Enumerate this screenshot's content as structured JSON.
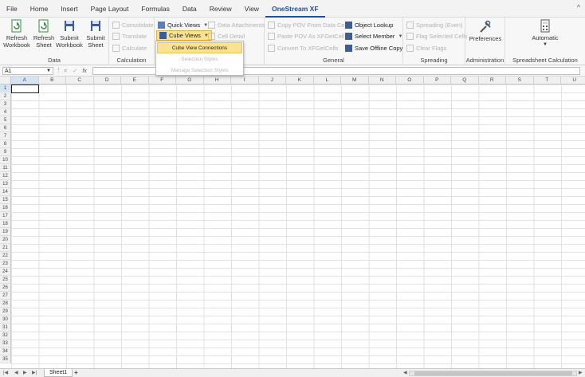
{
  "menu": {
    "tabs": [
      "File",
      "Home",
      "Insert",
      "Page Layout",
      "Formulas",
      "Data",
      "Review",
      "View",
      "OneStream XF"
    ],
    "active": "OneStream XF",
    "collapse": "^"
  },
  "ribbon": {
    "data_group": {
      "label": "Data",
      "refresh_workbook": "Refresh\nWorkbook",
      "refresh_sheet": "Refresh\nSheet",
      "submit_workbook": "Submit\nWorkbook",
      "submit_sheet": "Submit\nSheet"
    },
    "calculation_group": {
      "label": "Calculation",
      "consolidate": "Consolidate",
      "translate": "Translate",
      "calculate": "Calculate"
    },
    "views_group": {
      "quick_views": "Quick Views",
      "cube_views": "Cube Views",
      "data_attachments": "Data Attachments",
      "cell_detail": "Cell Detail"
    },
    "general_group": {
      "label": "General",
      "copy_pov": "Copy POV From Data Cell",
      "paste_pov": "Paste POV As XFGetCell",
      "convert": "Convert To XFGetCells",
      "object_lookup": "Object Lookup",
      "select_member": "Select Member",
      "save_offline": "Save Offline Copy"
    },
    "spreading_group": {
      "label": "Spreading",
      "spreading": "Spreading (Even)",
      "flag_cells": "Flag Selected Cells",
      "clear_flags": "Clear Flags"
    },
    "administration_group": {
      "label": "Administration",
      "preferences": "Preferences"
    },
    "calc_group": {
      "label": "Spreadsheet Calculation",
      "automatic": "Automatic"
    }
  },
  "dropdown": {
    "items": [
      "Cube View Connections",
      "Selection Styles",
      "Manage Selection Styles"
    ]
  },
  "formula_bar": {
    "name_box": "A1",
    "value": ""
  },
  "grid": {
    "columns": [
      "A",
      "B",
      "C",
      "D",
      "E",
      "F",
      "G",
      "H",
      "I",
      "J",
      "K",
      "L",
      "M",
      "N",
      "O",
      "P",
      "Q",
      "R",
      "S",
      "T",
      "U"
    ],
    "rows": [
      "1",
      "2",
      "3",
      "4",
      "5",
      "6",
      "7",
      "8",
      "9",
      "10",
      "11",
      "12",
      "13",
      "14",
      "15",
      "16",
      "17",
      "18",
      "19",
      "20",
      "21",
      "22",
      "23",
      "24",
      "25",
      "26",
      "27",
      "28",
      "29",
      "30",
      "31",
      "32",
      "33",
      "34",
      "35"
    ]
  },
  "sheets": {
    "active": "Sheet1",
    "add": "+"
  },
  "colors": {
    "accent": "#1e4e9c",
    "highlight": "#fbe28f",
    "disabled": "#b3b3b3"
  }
}
